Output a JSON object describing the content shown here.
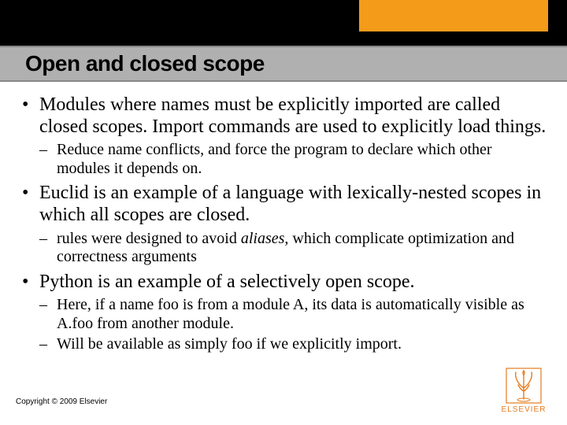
{
  "title": "Open and closed scope",
  "bullets": [
    {
      "text": "Modules where names must be explicitly imported are called closed scopes.  Import commands are used to explicitly load things.",
      "sub": [
        {
          "text": "Reduce name conflicts, and force the program to declare which other modules it depends on."
        }
      ]
    },
    {
      "text": "Euclid is an example of a language with lexically-nested scopes in which all scopes are closed.",
      "sub": [
        {
          "prefix": "rules were designed to avoid ",
          "italic": "aliases",
          "suffix": ", which complicate optimization and correctness arguments"
        }
      ]
    },
    {
      "text": "Python is an example of a selectively open scope.",
      "sub": [
        {
          "text": "Here, if a name foo is from a module A, its data is automatically visible as A.foo from another module."
        },
        {
          "text": "Will be available as simply foo if we explicitly import."
        }
      ]
    }
  ],
  "copyright": "Copyright © 2009 Elsevier",
  "logo_label": "ELSEVIER"
}
